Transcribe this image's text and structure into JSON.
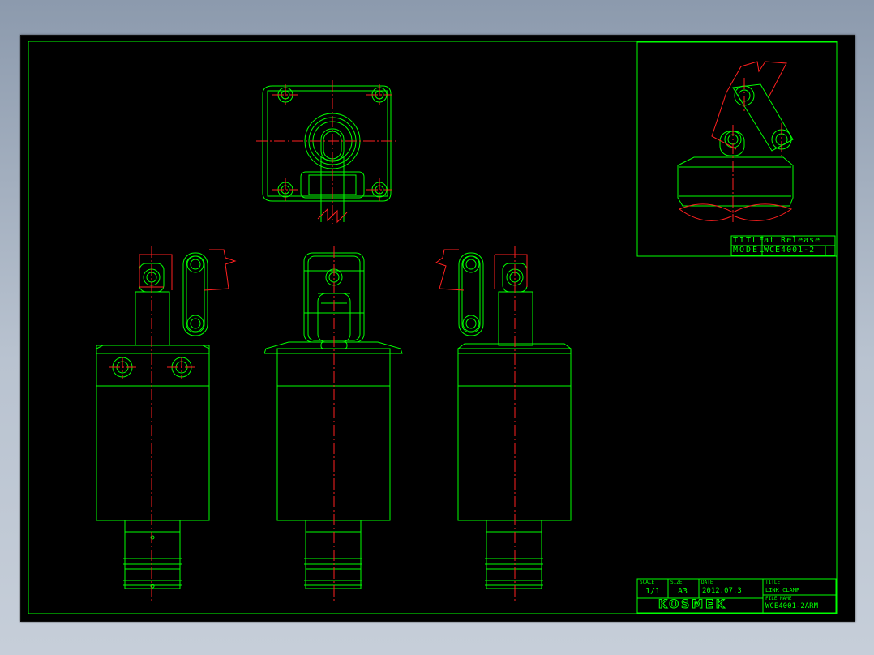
{
  "colors": {
    "line": "#00ff00",
    "centerline": "#ff2020",
    "background": "#000000"
  },
  "inset": {
    "title_label": "TITLE",
    "title_value": "at Release",
    "model_label": "MODEL",
    "model_value": "WCE4001-2"
  },
  "title_block": {
    "scale_label": "SCALE",
    "scale_value": "1/1",
    "size_label": "SIZE",
    "size_value": "A3",
    "date_label": "DATE",
    "date_value": "2012.07.3",
    "title_label": "TITLE",
    "title_value": "LINK CLAMP",
    "file_label": "FILE NAME",
    "file_value": "WCE4001-2ARM",
    "logo": "KOSMEK"
  }
}
